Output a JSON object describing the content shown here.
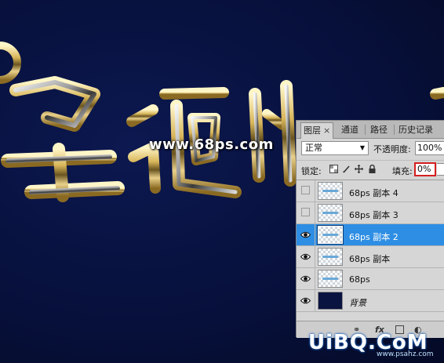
{
  "artwork": {
    "url_text": "www.68ps.com",
    "glyphs_description_hidden": ""
  },
  "layers_panel": {
    "tabs": [
      {
        "label": "图层",
        "active": true,
        "close": "×"
      },
      {
        "label": "通道",
        "active": false
      },
      {
        "label": "路径",
        "active": false
      },
      {
        "label": "历史记录",
        "active": false
      }
    ],
    "blend_mode": "正常",
    "opacity_label": "不透明度:",
    "opacity_value": "100%",
    "lock_label": "锁定:",
    "fill_label": "填充:",
    "fill_value": "0%",
    "layers": [
      {
        "name": "68ps 副本 4",
        "visible": false,
        "selected": false
      },
      {
        "name": "68ps 副本 3",
        "visible": false,
        "selected": false
      },
      {
        "name": "68ps 副本 2",
        "visible": true,
        "selected": true
      },
      {
        "name": "68ps  副本",
        "visible": true,
        "selected": false
      },
      {
        "name": "68ps",
        "visible": true,
        "selected": false
      },
      {
        "name": "背景",
        "visible": true,
        "selected": false
      }
    ],
    "bottom_icons": [
      "link-icon",
      "fx-icon",
      "mask-icon",
      "adjustment-icon"
    ]
  },
  "watermark": {
    "text": "UiBQ.CoM",
    "sub": "www.psahz.com"
  },
  "colors": {
    "canvas_bg": "#07103a",
    "selected_layer": "#2e8ee4",
    "fill_highlight": "#d42020"
  }
}
